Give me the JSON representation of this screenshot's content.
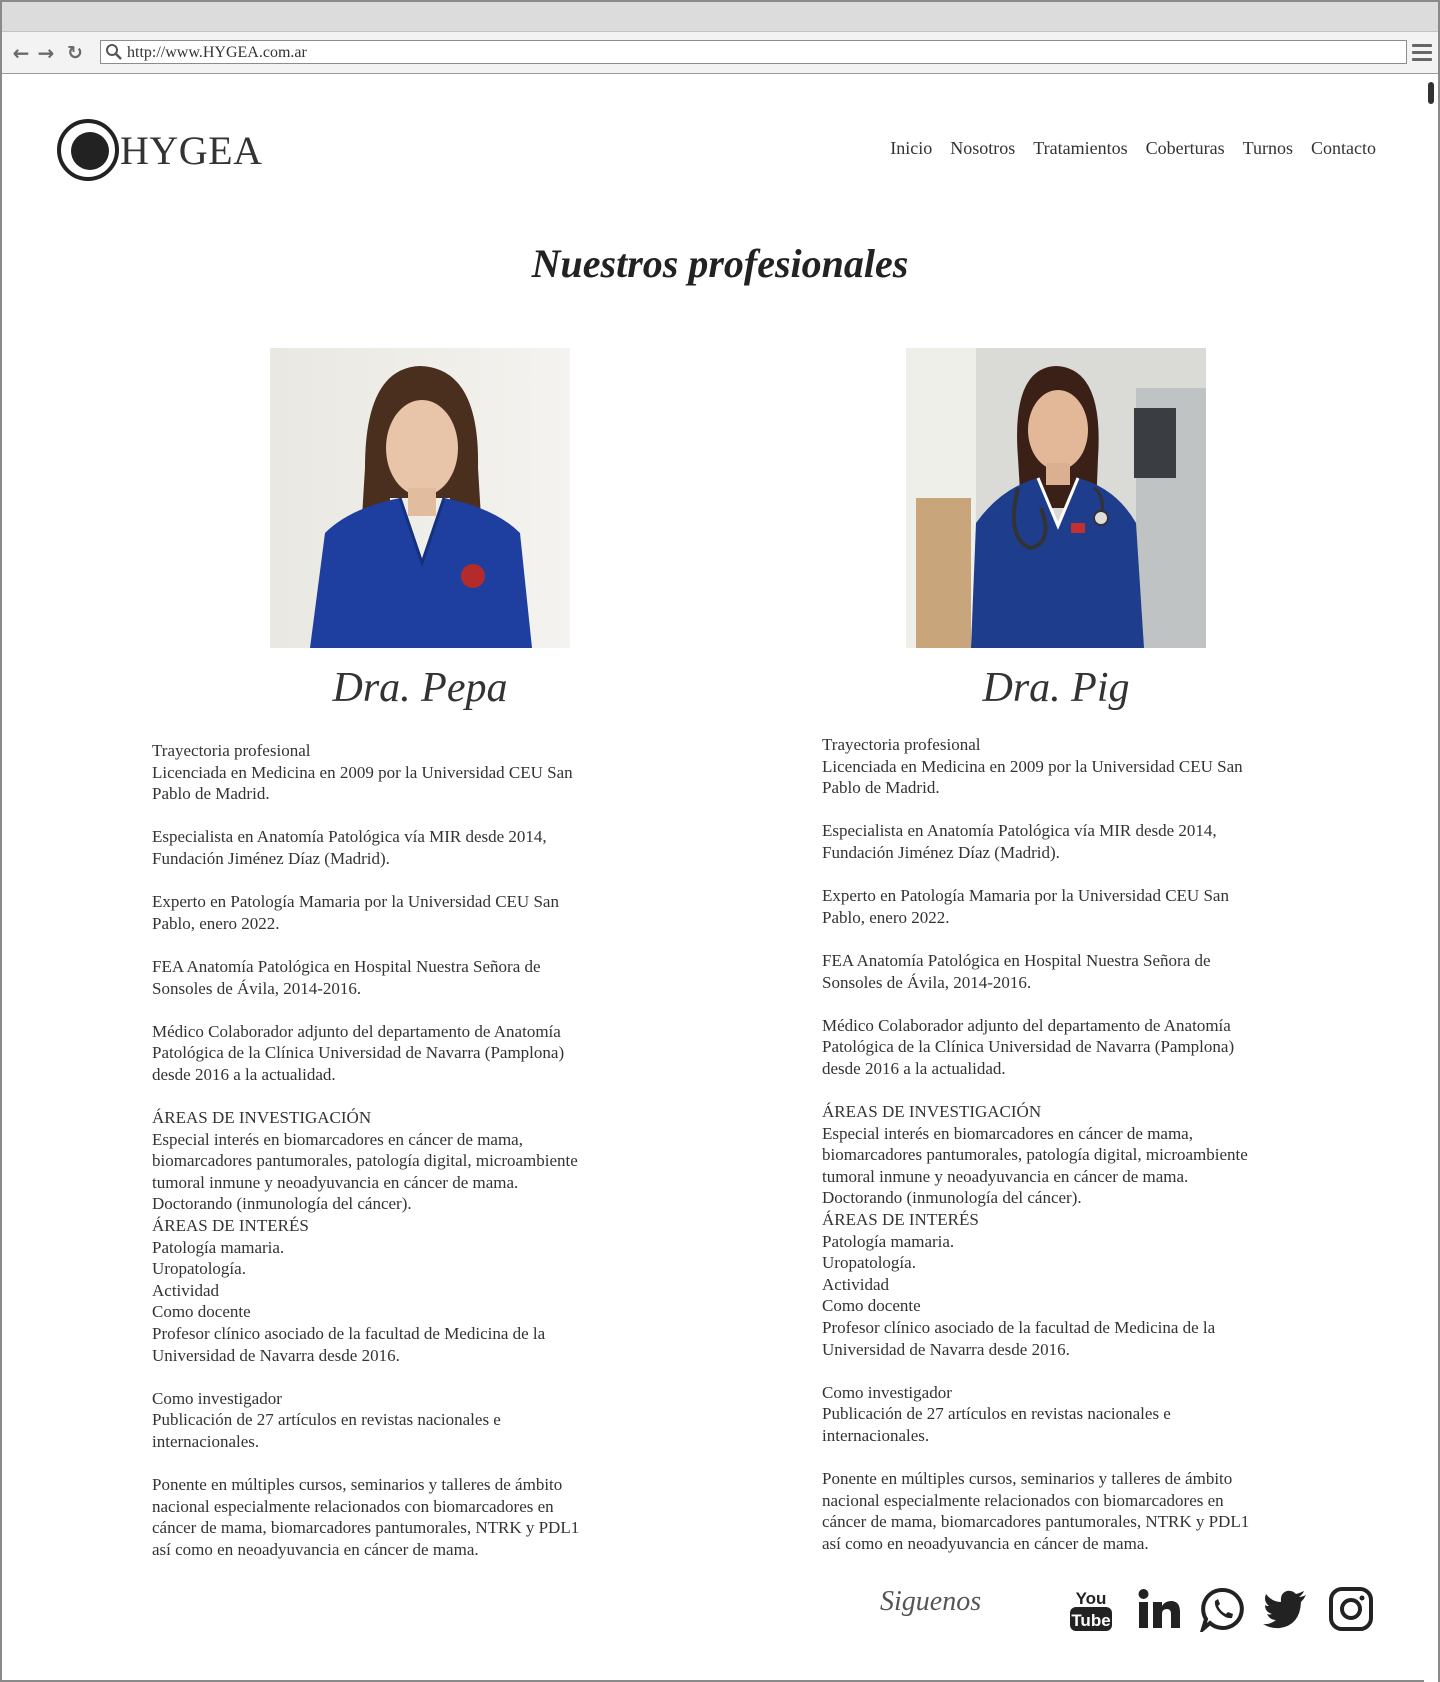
{
  "browser": {
    "url": "http://www.HYGEA.com.ar"
  },
  "site": {
    "brand": "HYGEA",
    "nav": [
      "Inicio",
      "Nosotros",
      "Tratamientos",
      "Coberturas",
      "Turnos",
      "Contacto"
    ],
    "page_title": "Nuestros profesionales"
  },
  "profiles": [
    {
      "name": "Dra. Pepa",
      "bio": [
        "Trayectoria profesional",
        "Licenciada en Medicina en 2009 por la Universidad CEU San",
        "Pablo de Madrid.",
        "",
        "Especialista en Anatomía Patológica vía MIR desde 2014,",
        "Fundación Jiménez Díaz (Madrid).",
        "",
        "Experto en Patología Mamaria por la Universidad CEU San",
        "Pablo, enero 2022.",
        "",
        "FEA Anatomía Patológica en Hospital Nuestra Señora de",
        "Sonsoles de Ávila, 2014-2016.",
        "",
        "Médico Colaborador adjunto del departamento de Anatomía",
        "Patológica de la Clínica Universidad de Navarra (Pamplona)",
        "desde 2016 a la actualidad.",
        "",
        "ÁREAS DE INVESTIGACIÓN",
        "Especial interés en biomarcadores en cáncer de mama,",
        "biomarcadores pantumorales, patología digital, microambiente",
        "tumoral inmune y neoadyuvancia en cáncer de mama.",
        "Doctorando (inmunología del cáncer).",
        "ÁREAS DE INTERÉS",
        "Patología mamaria.",
        "Uropatología.",
        "Actividad",
        "Como docente",
        "Profesor clínico asociado de la facultad de Medicina de la",
        "Universidad de Navarra desde 2016.",
        "",
        "Como investigador",
        "Publicación de 27 artículos en revistas nacionales e",
        "internacionales.",
        "",
        "Ponente en múltiples cursos, seminarios y talleres de ámbito",
        "nacional especialmente relacionados con biomarcadores en",
        "cáncer de mama, biomarcadores pantumorales, NTRK y PDL1",
        "así como en neoadyuvancia en cáncer de mama."
      ]
    },
    {
      "name": "Dra. Pig",
      "bio": [
        "Trayectoria profesional",
        "Licenciada en Medicina en 2009 por la Universidad CEU San",
        "Pablo de Madrid.",
        "",
        "Especialista en Anatomía Patológica vía MIR desde 2014,",
        "Fundación Jiménez Díaz (Madrid).",
        "",
        "Experto en Patología Mamaria por la Universidad CEU San",
        "Pablo, enero 2022.",
        "",
        "FEA Anatomía Patológica en Hospital Nuestra Señora de",
        "Sonsoles de Ávila, 2014-2016.",
        "",
        "Médico Colaborador adjunto del departamento de Anatomía",
        "Patológica de la Clínica Universidad de Navarra (Pamplona)",
        "desde 2016 a la actualidad.",
        "",
        "ÁREAS DE INVESTIGACIÓN",
        "Especial interés en biomarcadores en cáncer de mama,",
        "biomarcadores pantumorales, patología digital, microambiente",
        "tumoral inmune y neoadyuvancia en cáncer de mama.",
        "Doctorando (inmunología del cáncer).",
        "ÁREAS DE INTERÉS",
        "Patología mamaria.",
        "Uropatología.",
        "Actividad",
        "Como docente",
        "Profesor clínico asociado de la facultad de Medicina de la",
        "Universidad de Navarra desde 2016.",
        "",
        "Como investigador",
        "Publicación de 27 artículos en revistas nacionales e",
        "internacionales.",
        "",
        "Ponente en múltiples cursos, seminarios y talleres de ámbito",
        "nacional especialmente relacionados con biomarcadores en",
        "cáncer de mama, biomarcadores pantumorales, NTRK y PDL1",
        "así como en neoadyuvancia en cáncer de mama."
      ]
    }
  ],
  "footer": {
    "follow_label": "Siguenos",
    "social": [
      "youtube-icon",
      "linkedin-icon",
      "whatsapp-icon",
      "twitter-icon",
      "instagram-icon"
    ]
  }
}
